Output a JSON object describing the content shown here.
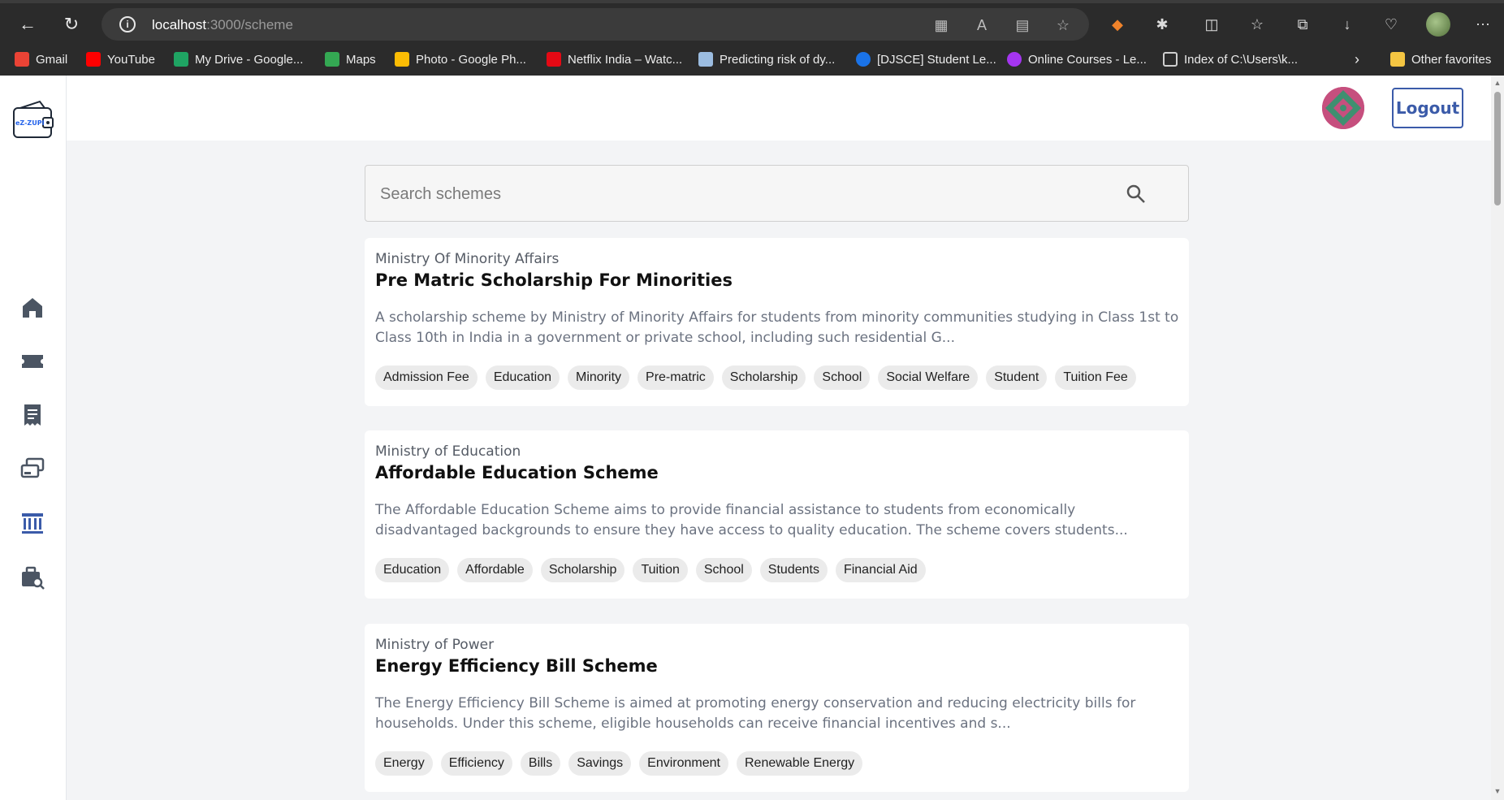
{
  "browser": {
    "url_host": "localhost",
    "url_rest": ":3000/scheme",
    "bookmarks": [
      {
        "label": "Gmail",
        "color": "#ea4335"
      },
      {
        "label": "YouTube",
        "color": "#ff0000"
      },
      {
        "label": "My Drive - Google...",
        "color": "#1fa463"
      },
      {
        "label": "Maps",
        "color": "#34a853"
      },
      {
        "label": "Photo - Google Ph...",
        "color": "#fbbc04"
      },
      {
        "label": "Netflix India – Watc...",
        "color": "#e50914"
      },
      {
        "label": "Predicting risk of dy...",
        "color": "#9bbce0"
      },
      {
        "label": "[DJSCE] Student Le...",
        "color": "#1a73e8"
      },
      {
        "label": "Online Courses - Le...",
        "color": "#a435f0"
      },
      {
        "label": "Index of C:\\Users\\k...",
        "color": "#cfcfcf"
      }
    ],
    "other_favorites": "Other favorites"
  },
  "header": {
    "logout_label": "Logout"
  },
  "logo": {
    "text": "eZ-ZUPI"
  },
  "sidebar": {
    "icons": [
      "home-icon",
      "ticket-icon",
      "receipt-icon",
      "cards-icon",
      "bank-icon",
      "job-search-icon"
    ],
    "accent": "#4b5563",
    "active_accent": "#3b5ba9"
  },
  "search": {
    "placeholder": "Search schemes"
  },
  "schemes": [
    {
      "ministry": "Ministry Of Minority Affairs",
      "title": "Pre Matric Scholarship For Minorities",
      "description": "A scholarship scheme by Ministry of Minority Affairs for students from minority communities studying in Class 1st to Class 10th in India in a government or private school, including such residential G...",
      "tags": [
        "Admission Fee",
        "Education",
        "Minority",
        "Pre-matric",
        "Scholarship",
        "School",
        "Social Welfare",
        "Student",
        "Tuition Fee"
      ]
    },
    {
      "ministry": "Ministry of Education",
      "title": "Affordable Education Scheme",
      "description": "The Affordable Education Scheme aims to provide financial assistance to students from economically disadvantaged backgrounds to ensure they have access to quality education. The scheme covers students...",
      "tags": [
        "Education",
        "Affordable",
        "Scholarship",
        "Tuition",
        "School",
        "Students",
        "Financial Aid"
      ]
    },
    {
      "ministry": "Ministry of Power",
      "title": "Energy Efficiency Bill Scheme",
      "description": "The Energy Efficiency Bill Scheme is aimed at promoting energy conservation and reducing electricity bills for households. Under this scheme, eligible households can receive financial incentives and s...",
      "tags": [
        "Energy",
        "Efficiency",
        "Bills",
        "Savings",
        "Environment",
        "Renewable Energy"
      ]
    }
  ]
}
